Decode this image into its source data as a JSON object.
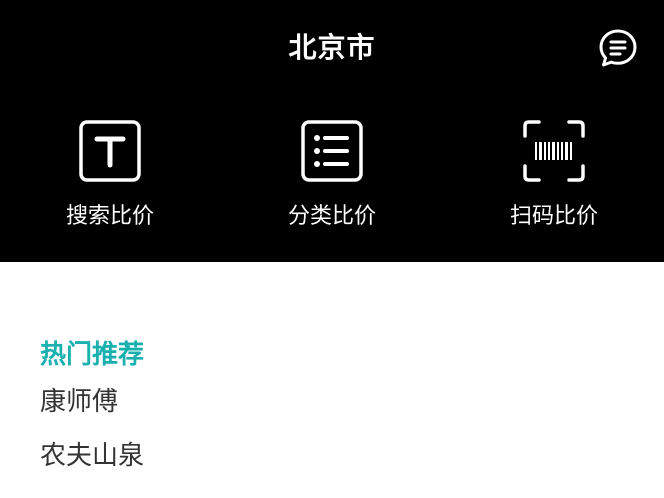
{
  "header": {
    "title": "北京市",
    "message_icon": "message-icon"
  },
  "actions": [
    {
      "label": "搜索比价",
      "icon": "text-t-icon"
    },
    {
      "label": "分类比价",
      "icon": "list-icon"
    },
    {
      "label": "扫码比价",
      "icon": "barcode-scan-icon"
    }
  ],
  "hot": {
    "title": "热门推荐",
    "items": [
      "康师傅",
      "农夫山泉"
    ]
  },
  "colors": {
    "header_bg": "#000000",
    "accent": "#1ab0b0"
  }
}
